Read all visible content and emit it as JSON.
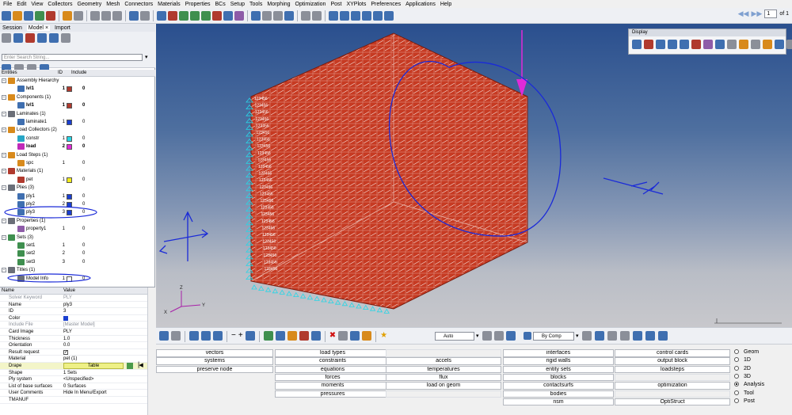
{
  "menu": [
    "File",
    "Edit",
    "View",
    "Collectors",
    "Geometry",
    "Mesh",
    "Connectors",
    "Materials",
    "Properties",
    "BCs",
    "Setup",
    "Tools",
    "Morphing",
    "Optimization",
    "Post",
    "XYPlots",
    "Preferences",
    "Applications",
    "Help"
  ],
  "pager": {
    "page": "1",
    "of": "of 1"
  },
  "left": {
    "tabs": [
      "Session",
      "Model",
      "Import"
    ],
    "search_placeholder": "Enter Search String...",
    "cols": {
      "entities": "Entities",
      "id": "ID",
      "include": "Include"
    },
    "tree": [
      {
        "lvl": 0,
        "label": "Assembly Hierarchy",
        "icon": "assembly-icon",
        "c": "#d88a1c"
      },
      {
        "lvl": 1,
        "label": "lvl1",
        "id": "1",
        "sw": "#b03a2e",
        "inc": "0",
        "bold": true,
        "icon": "component-icon",
        "c": "#3f6fb0"
      },
      {
        "lvl": 0,
        "label": "Components (1)",
        "icon": "components-icon",
        "c": "#d88a1c"
      },
      {
        "lvl": 1,
        "label": "lvl1",
        "id": "1",
        "sw": "#b03a2e",
        "inc": "0",
        "bold": true,
        "icon": "component-icon",
        "c": "#3f6fb0"
      },
      {
        "lvl": 0,
        "label": "Laminates (1)",
        "icon": "laminates-icon",
        "c": "#6a6e78"
      },
      {
        "lvl": 1,
        "label": "laminate1",
        "id": "1",
        "sw": "#1a3fd0",
        "inc": "0",
        "icon": "laminate-icon",
        "c": "#3f6fb0"
      },
      {
        "lvl": 0,
        "label": "Load Collectors (2)",
        "icon": "load-collectors-icon",
        "c": "#d88a1c"
      },
      {
        "lvl": 1,
        "label": "constr",
        "id": "1",
        "sw": "#27d6e6",
        "inc": "0",
        "icon": "load-collector-icon",
        "c": "#27a6c6"
      },
      {
        "lvl": 1,
        "label": "load",
        "id": "2",
        "sw": "#e02ad8",
        "inc": "0",
        "bold": true,
        "icon": "load-collector-icon",
        "c": "#c02ab8"
      },
      {
        "lvl": 0,
        "label": "Load Steps (1)",
        "icon": "load-steps-icon",
        "c": "#d88a1c"
      },
      {
        "lvl": 1,
        "label": "spc",
        "id": "1",
        "inc": "0",
        "icon": "load-step-icon",
        "c": "#d88a1c"
      },
      {
        "lvl": 0,
        "label": "Materials (1)",
        "icon": "materials-icon",
        "c": "#b03a2e"
      },
      {
        "lvl": 1,
        "label": "pet",
        "id": "1",
        "sw": "#f2ec1a",
        "inc": "0",
        "icon": "material-icon",
        "c": "#b03a2e"
      },
      {
        "lvl": 0,
        "label": "Plies (3)",
        "icon": "plies-icon",
        "c": "#6a6e78"
      },
      {
        "lvl": 1,
        "label": "ply1",
        "id": "1",
        "sw": "#1a3fd0",
        "inc": "0",
        "icon": "ply-icon",
        "c": "#3f6fb0"
      },
      {
        "lvl": 1,
        "label": "ply2",
        "id": "2",
        "sw": "#1a3fd0",
        "inc": "0",
        "icon": "ply-icon",
        "c": "#3f6fb0"
      },
      {
        "lvl": 1,
        "label": "ply3",
        "id": "3",
        "sw": "#1a3fd0",
        "inc": "0",
        "icon": "ply-icon",
        "c": "#3f6fb0"
      },
      {
        "lvl": 0,
        "label": "Properties (1)",
        "icon": "properties-icon",
        "c": "#6a6e78"
      },
      {
        "lvl": 1,
        "label": "property1",
        "id": "1",
        "inc": "0",
        "icon": "property-icon",
        "c": "#8e5ca8"
      },
      {
        "lvl": 0,
        "label": "Sets (3)",
        "icon": "sets-icon",
        "c": "#3f8f4f"
      },
      {
        "lvl": 1,
        "label": "set1",
        "id": "1",
        "inc": "0",
        "icon": "set-icon",
        "c": "#3f8f4f"
      },
      {
        "lvl": 1,
        "label": "set2",
        "id": "2",
        "inc": "0",
        "icon": "set-icon",
        "c": "#3f8f4f"
      },
      {
        "lvl": 1,
        "label": "set3",
        "id": "3",
        "inc": "0",
        "icon": "set-icon",
        "c": "#3f8f4f"
      },
      {
        "lvl": 0,
        "label": "Titles (1)",
        "icon": "titles-icon",
        "c": "#6a6e78"
      },
      {
        "lvl": 1,
        "label": "Model Info",
        "id": "1",
        "sw": "#ffffff",
        "inc": "0",
        "icon": "title-icon",
        "c": "#6a6e78"
      }
    ],
    "props_head": {
      "name": "Name",
      "value": "Value"
    },
    "props": [
      {
        "k": "Solver Keyword",
        "v": "PLY",
        "gray": true
      },
      {
        "k": "Name",
        "v": "ply3"
      },
      {
        "k": "ID",
        "v": "3"
      },
      {
        "k": "Color",
        "v": "",
        "swatch": "#1a3fd0"
      },
      {
        "k": "Include File",
        "v": "[Master Model]",
        "gray": true
      },
      {
        "k": "Card Image",
        "v": "PLY"
      },
      {
        "k": "Thickness",
        "v": "1.0"
      },
      {
        "k": "Orientation",
        "v": "0.0"
      },
      {
        "k": "Result request",
        "v": "",
        "check": true
      },
      {
        "k": "Material",
        "v": "pet (1)"
      },
      {
        "k": "Drape",
        "v": "Table",
        "drape": true
      },
      {
        "k": "Shape",
        "v": "1 Sets"
      },
      {
        "k": "Ply system",
        "v": "<Unspecified>"
      },
      {
        "k": "List of base surfaces",
        "v": "0 Surfaces"
      },
      {
        "k": "User Comments",
        "v": "Hide In Menu/Export"
      },
      {
        "k": "TMANUF",
        "v": ""
      }
    ]
  },
  "display_panel": {
    "title": "Display"
  },
  "model": {
    "cube_face": "#c63a22",
    "cube_side": "#a92d18",
    "cube_top": "#d44a30",
    "node_label": "123456",
    "scale_label": "Model Info"
  },
  "viewbar": {
    "auto": "Auto",
    "bycomp": "By Comp"
  },
  "panel": {
    "cols": [
      [
        "vectors",
        "systems",
        "preserve node"
      ],
      [
        "load types",
        "constraints",
        "equations",
        "forces",
        "moments",
        "pressures"
      ],
      [
        "",
        "accels",
        "temperatures",
        "flux",
        "load on geom",
        ""
      ],
      [
        "interfaces",
        "rigid walls",
        "entity sets",
        "blocks",
        "contactsurfs",
        "bodies",
        "nsm"
      ],
      [
        "control cards",
        "output block",
        "loadsteps",
        "",
        "optimization",
        "",
        "OptiStruct"
      ]
    ],
    "radios": [
      "Geom",
      "1D",
      "2D",
      "3D",
      "Analysis",
      "Tool",
      "Post"
    ],
    "radio_selected": "Analysis"
  }
}
